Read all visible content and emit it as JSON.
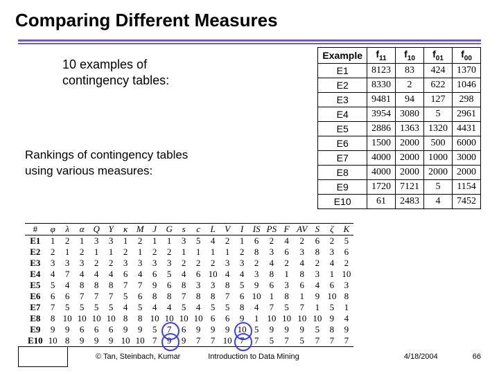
{
  "title": "Comparing Different Measures",
  "caption1_l1": "10 examples of",
  "caption1_l2": "contingency tables:",
  "caption2_l1": "Rankings of contingency tables",
  "caption2_l2": "using various measures:",
  "ct": {
    "headers": [
      "Example",
      "f11",
      "f10",
      "f01",
      "f00"
    ],
    "header_subs": [
      "",
      "11",
      "10",
      "01",
      "00"
    ],
    "rows": [
      [
        "E1",
        8123,
        83,
        424,
        1370
      ],
      [
        "E2",
        8330,
        2,
        622,
        1046
      ],
      [
        "E3",
        9481,
        94,
        127,
        298
      ],
      [
        "E4",
        3954,
        3080,
        5,
        2961
      ],
      [
        "E5",
        2886,
        1363,
        1320,
        4431
      ],
      [
        "E6",
        1500,
        2000,
        500,
        6000
      ],
      [
        "E7",
        4000,
        2000,
        1000,
        3000
      ],
      [
        "E8",
        4000,
        2000,
        2000,
        2000
      ],
      [
        "E9",
        1720,
        7121,
        5,
        1154
      ],
      [
        "E10",
        61,
        2483,
        4,
        7452
      ]
    ]
  },
  "rank": {
    "headers": [
      "#",
      "φ",
      "λ",
      "α",
      "Q",
      "Y",
      "κ",
      "M",
      "J",
      "G",
      "s",
      "c",
      "L",
      "V",
      "I",
      "IS",
      "PS",
      "F",
      "AV",
      "S",
      "ζ",
      "K"
    ],
    "rows": [
      [
        "E1",
        1,
        2,
        1,
        3,
        3,
        1,
        2,
        1,
        1,
        3,
        5,
        4,
        2,
        1,
        6,
        2,
        4,
        2,
        6,
        2,
        5
      ],
      [
        "E2",
        2,
        1,
        2,
        1,
        1,
        2,
        1,
        2,
        2,
        1,
        1,
        1,
        1,
        2,
        8,
        3,
        6,
        3,
        8,
        3,
        6
      ],
      [
        "E3",
        3,
        3,
        3,
        2,
        2,
        3,
        3,
        3,
        3,
        2,
        2,
        2,
        3,
        3,
        2,
        4,
        2,
        4,
        2,
        4,
        2
      ],
      [
        "E4",
        4,
        7,
        4,
        4,
        4,
        6,
        4,
        6,
        5,
        4,
        6,
        10,
        4,
        4,
        3,
        8,
        1,
        8,
        3,
        1,
        10
      ],
      [
        "E5",
        5,
        4,
        8,
        8,
        8,
        7,
        7,
        9,
        6,
        8,
        3,
        3,
        8,
        5,
        9,
        6,
        3,
        6,
        4,
        6,
        3
      ],
      [
        "E6",
        6,
        6,
        7,
        7,
        7,
        5,
        6,
        8,
        8,
        7,
        8,
        8,
        7,
        6,
        10,
        1,
        8,
        1,
        9,
        10,
        8
      ],
      [
        "E7",
        7,
        5,
        5,
        5,
        5,
        4,
        5,
        4,
        4,
        5,
        4,
        5,
        5,
        8,
        4,
        7,
        5,
        7,
        1,
        5,
        1
      ],
      [
        "E8",
        8,
        10,
        10,
        10,
        10,
        8,
        8,
        10,
        10,
        10,
        10,
        6,
        6,
        9,
        1,
        10,
        10,
        10,
        10,
        9,
        4
      ],
      [
        "E9",
        9,
        9,
        6,
        6,
        6,
        9,
        9,
        5,
        7,
        6,
        9,
        9,
        9,
        10,
        5,
        9,
        9,
        9,
        5,
        8,
        9
      ],
      [
        "E10",
        10,
        8,
        9,
        9,
        9,
        10,
        10,
        7,
        9,
        9,
        7,
        7,
        10,
        7,
        7,
        5,
        7,
        5,
        7,
        7,
        7
      ]
    ],
    "circles": [
      {
        "row": 8,
        "row_label": "E9",
        "col": 9
      },
      {
        "row": 9,
        "row_label": "E10",
        "col": 9
      },
      {
        "row": 8,
        "row_label": "E9",
        "col": 14
      },
      {
        "row": 9,
        "row_label": "E10",
        "col": 14
      }
    ]
  },
  "footer": {
    "credits": "© Tan, Steinbach, Kumar",
    "intro": "Introduction to Data Mining",
    "date": "4/18/2004",
    "page": "66"
  },
  "chart_data": [
    {
      "type": "table",
      "title": "Contingency table examples",
      "columns": [
        "Example",
        "f11",
        "f10",
        "f01",
        "f00"
      ],
      "rows": [
        [
          "E1",
          8123,
          83,
          424,
          1370
        ],
        [
          "E2",
          8330,
          2,
          622,
          1046
        ],
        [
          "E3",
          9481,
          94,
          127,
          298
        ],
        [
          "E4",
          3954,
          3080,
          5,
          2961
        ],
        [
          "E5",
          2886,
          1363,
          1320,
          4431
        ],
        [
          "E6",
          1500,
          2000,
          500,
          6000
        ],
        [
          "E7",
          4000,
          2000,
          1000,
          3000
        ],
        [
          "E8",
          4000,
          2000,
          2000,
          2000
        ],
        [
          "E9",
          1720,
          7121,
          5,
          1154
        ],
        [
          "E10",
          61,
          2483,
          4,
          7452
        ]
      ]
    },
    {
      "type": "table",
      "title": "Rankings of contingency tables using various measures",
      "columns": [
        "#",
        "φ",
        "λ",
        "α",
        "Q",
        "Y",
        "κ",
        "M",
        "J",
        "G",
        "s",
        "c",
        "L",
        "V",
        "I",
        "IS",
        "PS",
        "F",
        "AV",
        "S",
        "ζ",
        "K"
      ],
      "rows": [
        [
          "E1",
          1,
          2,
          1,
          3,
          3,
          1,
          2,
          1,
          1,
          3,
          5,
          4,
          2,
          1,
          6,
          2,
          4,
          2,
          6,
          2,
          5
        ],
        [
          "E2",
          2,
          1,
          2,
          1,
          1,
          2,
          1,
          2,
          2,
          1,
          1,
          1,
          1,
          2,
          8,
          3,
          6,
          3,
          8,
          3,
          6
        ],
        [
          "E3",
          3,
          3,
          3,
          2,
          2,
          3,
          3,
          3,
          3,
          2,
          2,
          2,
          3,
          3,
          2,
          4,
          2,
          4,
          2,
          4,
          2
        ],
        [
          "E4",
          4,
          7,
          4,
          4,
          4,
          6,
          4,
          6,
          5,
          4,
          6,
          10,
          4,
          4,
          3,
          8,
          1,
          8,
          3,
          1,
          10
        ],
        [
          "E5",
          5,
          4,
          8,
          8,
          8,
          7,
          7,
          9,
          6,
          8,
          3,
          3,
          8,
          5,
          9,
          6,
          3,
          6,
          4,
          6,
          3
        ],
        [
          "E6",
          6,
          6,
          7,
          7,
          7,
          5,
          6,
          8,
          8,
          7,
          8,
          8,
          7,
          6,
          10,
          1,
          8,
          1,
          9,
          10,
          8
        ],
        [
          "E7",
          7,
          5,
          5,
          5,
          5,
          4,
          5,
          4,
          4,
          5,
          4,
          5,
          5,
          8,
          4,
          7,
          5,
          7,
          1,
          5,
          1
        ],
        [
          "E8",
          8,
          10,
          10,
          10,
          10,
          8,
          8,
          10,
          10,
          10,
          10,
          6,
          6,
          9,
          1,
          10,
          10,
          10,
          10,
          9,
          4
        ],
        [
          "E9",
          9,
          9,
          6,
          6,
          6,
          9,
          9,
          5,
          7,
          6,
          9,
          9,
          9,
          10,
          5,
          9,
          9,
          9,
          5,
          8,
          9
        ],
        [
          "E10",
          10,
          8,
          9,
          9,
          9,
          10,
          10,
          7,
          9,
          9,
          7,
          7,
          10,
          7,
          7,
          5,
          7,
          5,
          7,
          7,
          7
        ]
      ]
    }
  ]
}
